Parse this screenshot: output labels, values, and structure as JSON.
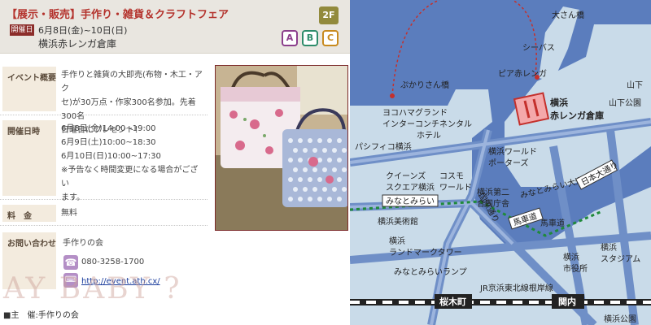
{
  "event": {
    "title": "【展示・販売】手作り・雑貨＆クラフトフェア",
    "date_badge": "開催日",
    "dates": "6月8日(金)~10日(日)",
    "venue": "横浜赤レンガ倉庫",
    "floor": "2F",
    "categories": [
      "A",
      "B",
      "C"
    ],
    "category_colors": [
      "#8c3f8c",
      "#2e8c6a",
      "#c88a1e"
    ]
  },
  "details": {
    "overview_label": "イベント概要",
    "overview_lines": [
      "手作りと雑貨の大即売(布物・木工・アク",
      "セ)が30万点・作家300名参加。先着300名",
      "日曜日にプレゼント！"
    ],
    "schedule_label": "開催日時",
    "schedule_lines": [
      "6月8日(金)14:00~19:00",
      "6月9日(土)10:00~18:30",
      "6月10日(日)10:00~17:30",
      "※予告なく時間変更になる場合がござい",
      "ます。"
    ],
    "fee_label": "料　金",
    "fee_value": "無料",
    "contact_label": "お問い合わせ",
    "contact_name": "手作りの会",
    "phone": "080-3258-1700",
    "url": "http://event.ath.cx/"
  },
  "footer": {
    "organizer": "■主　催:手作りの会",
    "watermark": "AY BABY ?"
  },
  "map": {
    "labels": {
      "osanbashi": "大さん橋",
      "seabass": "シーバス",
      "pier": "ピア赤レンガ",
      "pukari": "ぷかりさん橋",
      "yamashita": "山下",
      "yamashita_park": "山下公園",
      "yokohama_grand_1": "ヨコハマグランド",
      "yokohama_grand_2": "インターコンチネンタル",
      "yokohama_grand_3": "ホテル",
      "pacifico": "パシフィコ横浜",
      "redbrick_1": "横浜",
      "redbrick_2": "赤レンガ倉庫",
      "world_porters_1": "横浜ワールド",
      "world_porters_2": "ポーターズ",
      "cosmo_1": "コスモ",
      "cosmo_2": "ワールド",
      "queens_1": "クイーンズ",
      "queens_2": "スクエア横浜",
      "minatomirai_station": "みなとみらい",
      "kokudo": "国際通り",
      "godo_1": "横浜第二",
      "godo_2": "合同庁舎",
      "minatomirai_odori": "みなとみらい大通り",
      "nihon_odori": "日本大通り",
      "bashamichi": "馬車道",
      "bashamichi_st": "馬車道",
      "art_museum": "横浜美術館",
      "landmark_1": "横浜",
      "landmark_2": "ランドマークタワー",
      "minatomirai_lamp": "みなとみらいランプ",
      "shiyakusho_1": "横浜",
      "shiyakusho_2": "市役所",
      "stadium_1": "横浜",
      "stadium_2": "スタジアム",
      "sakuragicho": "桜木町",
      "kannai": "関内",
      "jr_line": "JR京浜東北線根岸線",
      "yokohama_park": "横浜公園"
    }
  }
}
